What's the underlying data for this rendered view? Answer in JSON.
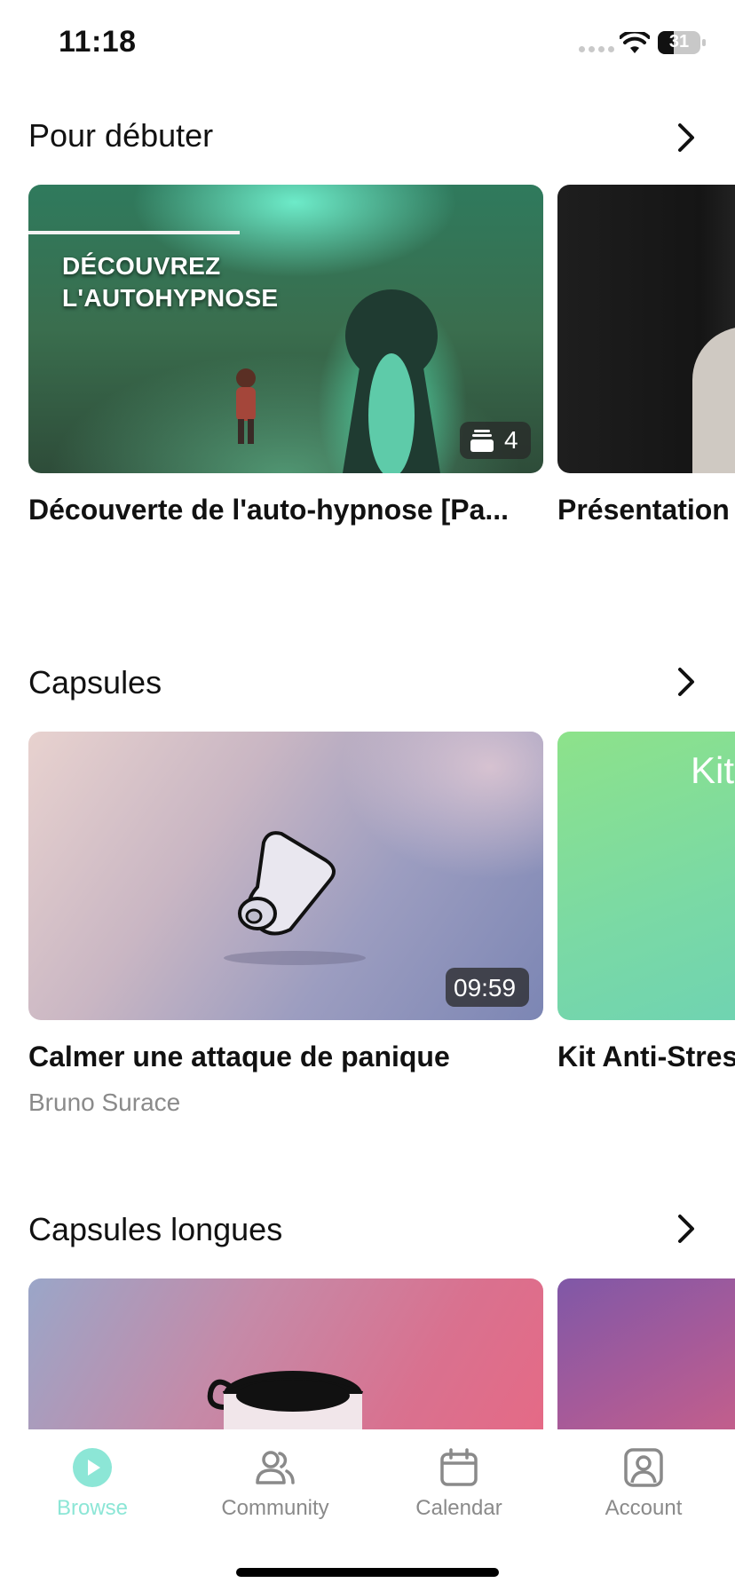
{
  "status": {
    "time": "11:18",
    "battery": "31"
  },
  "sections": [
    {
      "title": "Pour débuter",
      "cards": [
        {
          "title": "Découverte de l'auto-hypnose [Pa...",
          "headline_line1": "DÉCOUVREZ",
          "headline_line2": "L'AUTOHYPNOSE",
          "badge": "4",
          "badge_icon": "stack-icon"
        },
        {
          "title": "Présentation"
        }
      ]
    },
    {
      "title": "Capsules",
      "cards": [
        {
          "title": "Calmer une attaque de panique",
          "author": "Bruno Surace",
          "duration": "09:59"
        },
        {
          "title": "Kit Anti-Stres",
          "art_text": "Kit"
        }
      ]
    },
    {
      "title": "Capsules longues",
      "cards": []
    }
  ],
  "tabbar": {
    "items": [
      {
        "label": "Browse",
        "icon": "play-circle-icon",
        "active": true
      },
      {
        "label": "Community",
        "icon": "people-icon"
      },
      {
        "label": "Calendar",
        "icon": "calendar-icon"
      },
      {
        "label": "Account",
        "icon": "account-icon"
      }
    ]
  },
  "colors": {
    "accent": "#8ce6d6",
    "inactive": "#8a8a8a"
  }
}
